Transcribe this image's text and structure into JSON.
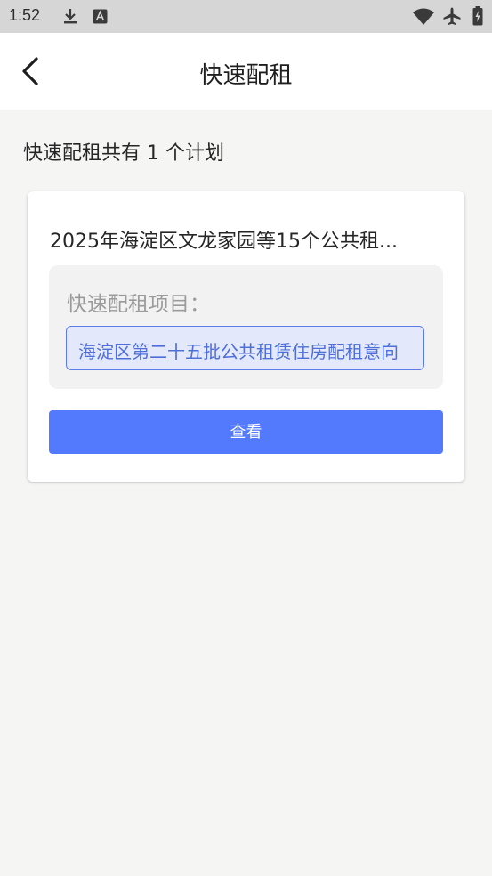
{
  "status_bar": {
    "time": "1:52",
    "icons": [
      "download-icon",
      "font-a-icon",
      "wifi-icon",
      "airplane-icon",
      "battery-icon"
    ]
  },
  "header": {
    "title": "快速配租",
    "back_icon": "chevron-left-icon"
  },
  "summary": {
    "text": "快速配租共有 1 个计划"
  },
  "plans": [
    {
      "title": "2025年海淀区文龙家园等15个公共租...",
      "project_label": "快速配租项目：",
      "project_name": "海淀区第二十五批公共租赁住房配租意向",
      "button_label": "查看"
    }
  ],
  "colors": {
    "accent": "#5379fd",
    "tag_border": "#5b7be8",
    "tag_background": "#e3e8fb",
    "page_background": "#f5f5f4"
  }
}
